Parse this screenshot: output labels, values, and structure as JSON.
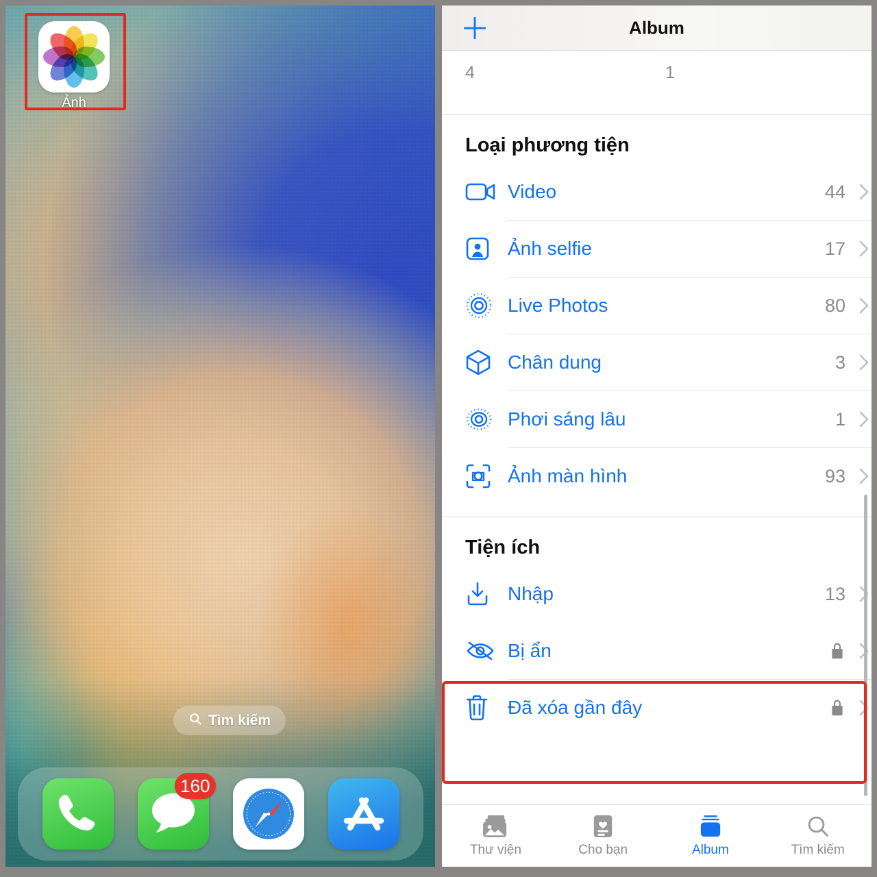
{
  "home": {
    "app_icon": {
      "label": "Ảnh",
      "name": "photos-app"
    },
    "search_pill": {
      "label": "Tìm kiếm",
      "icon": "search-icon"
    },
    "dock": [
      {
        "name": "phone",
        "label": "Phone",
        "badge": null
      },
      {
        "name": "messages",
        "label": "Messages",
        "badge": "160"
      },
      {
        "name": "safari",
        "label": "Safari",
        "badge": null
      },
      {
        "name": "app-store",
        "label": "App Store",
        "badge": null
      }
    ]
  },
  "album": {
    "nav": {
      "title": "Album",
      "add_icon": "plus-icon"
    },
    "partial_row": {
      "counts": [
        "4",
        "1"
      ]
    },
    "sections": [
      {
        "title": "Loại phương tiện",
        "rows": [
          {
            "icon": "video-icon",
            "label": "Video",
            "count": "44",
            "locked": false
          },
          {
            "icon": "selfie-icon",
            "label": "Ảnh selfie",
            "count": "17",
            "locked": false
          },
          {
            "icon": "live-photo-icon",
            "label": "Live Photos",
            "count": "80",
            "locked": false
          },
          {
            "icon": "cube-icon",
            "label": "Chân dung",
            "count": "3",
            "locked": false
          },
          {
            "icon": "long-exposure-icon",
            "label": "Phơi sáng lâu",
            "count": "1",
            "locked": false
          },
          {
            "icon": "screenshot-icon",
            "label": "Ảnh màn hình",
            "count": "93",
            "locked": false
          }
        ]
      },
      {
        "title": "Tiện ích",
        "rows": [
          {
            "icon": "import-icon",
            "label": "Nhập",
            "count": "13",
            "locked": false
          },
          {
            "icon": "eye-slash-icon",
            "label": "Bị ẩn",
            "count": "",
            "locked": true
          },
          {
            "icon": "trash-icon",
            "label": "Đã xóa gần đây",
            "count": "",
            "locked": true
          }
        ]
      }
    ],
    "tabs": [
      {
        "icon": "library-icon",
        "label": "Thư viện",
        "active": false
      },
      {
        "icon": "for-you-icon",
        "label": "Cho bạn",
        "active": false
      },
      {
        "icon": "albums-icon",
        "label": "Album",
        "active": true
      },
      {
        "icon": "search-icon",
        "label": "Tìm kiếm",
        "active": false
      }
    ]
  },
  "colors": {
    "accent_blue": "#1471f0",
    "highlight_red": "#e02b20",
    "secondary_gray": "#8a8a8e",
    "badge_red": "#e7342a"
  }
}
